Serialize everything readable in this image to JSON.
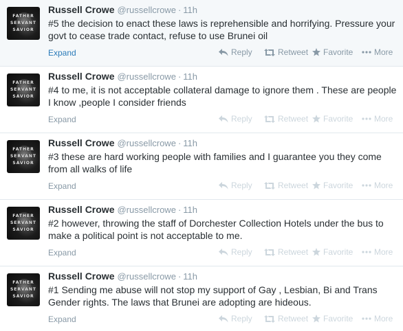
{
  "tweets": [
    {
      "name": "Russell Crowe",
      "handle": "@russellcrowe",
      "separator": "·",
      "time": "11h",
      "text": "#5 the decision  to enact these laws is reprehensible and horrifying. Pressure your govt to cease trade contact, refuse to use Brunei oil",
      "expand": "Expand",
      "state": "hover"
    },
    {
      "name": "Russell Crowe",
      "handle": "@russellcrowe",
      "separator": "·",
      "time": "11h",
      "text": "#4 to me, it is not acceptable collateral damage to ignore them . These are people I know ,people I consider friends",
      "expand": "Expand",
      "state": "dim"
    },
    {
      "name": "Russell Crowe",
      "handle": "@russellcrowe",
      "separator": "·",
      "time": "11h",
      "text": "#3 these are hard working people with families and I guarantee you they come from all walks of life",
      "expand": "Expand",
      "state": "dim"
    },
    {
      "name": "Russell Crowe",
      "handle": "@russellcrowe",
      "separator": "·",
      "time": "11h",
      "text": "#2 however, throwing the staff of Dorchester Collection Hotels under the bus to make a political point is not acceptable to me.",
      "expand": "Expand",
      "state": "dim"
    },
    {
      "name": "Russell Crowe",
      "handle": "@russellcrowe",
      "separator": "·",
      "time": "11h",
      "text": "#1 Sending me abuse will not stop my support of Gay , Lesbian, Bi and Trans Gender rights. The laws that Brunei are adopting are hideous.",
      "expand": "Expand",
      "state": "dim"
    }
  ],
  "actions": {
    "reply": "Reply",
    "retweet": "Retweet",
    "favorite": "Favorite",
    "more": "More"
  },
  "avatar_words": [
    "FATHER",
    "SERVANT",
    "SAVIOR"
  ],
  "icons": {
    "reply": "reply-icon",
    "retweet": "retweet-icon",
    "favorite": "star-icon",
    "more": "more-dots-icon"
  },
  "colors": {
    "link": "#2b7bb9",
    "muted": "#8899a6",
    "faded": "#ccd6dd",
    "hover_bg": "#f5f8fa"
  }
}
